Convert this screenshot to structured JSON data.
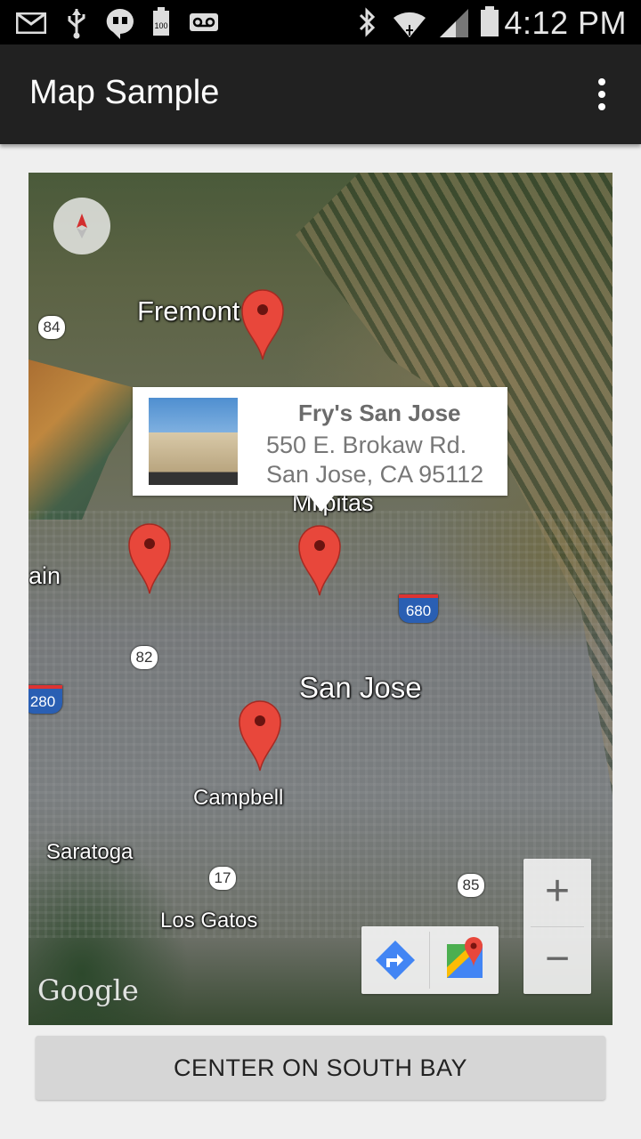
{
  "status_bar": {
    "time": "4:12 PM",
    "icons": [
      "email-icon",
      "usb-icon",
      "hangouts-icon",
      "battery-100-icon",
      "voicemail-icon",
      "bluetooth-icon",
      "wifi-icon",
      "signal-icon",
      "battery-icon"
    ]
  },
  "action_bar": {
    "title": "Map Sample",
    "menu_icon": "overflow-menu-icon"
  },
  "map": {
    "type": "satellite",
    "labels": {
      "fremont": "Fremont",
      "milpitas": "Milpitas",
      "san_jose": "San Jose",
      "campbell": "Campbell",
      "saratoga": "Saratoga",
      "los_gatos": "Los Gatos",
      "mountain_view_partial": "ain"
    },
    "route_shields": {
      "r84": "84",
      "r82": "82",
      "r680": "680",
      "r280": "280",
      "r17": "17",
      "r85": "85"
    },
    "info_window": {
      "title": "Fry's San Jose",
      "address_line1": "550 E. Brokaw Rd.",
      "address_line2": "San Jose, CA 95112"
    },
    "markers_count": 4,
    "attribution": "Google",
    "zoom_in_label": "+",
    "zoom_out_label": "−",
    "colors": {
      "marker": "#e8473b",
      "directions": "#4285f4"
    }
  },
  "bottom_button": {
    "label": "CENTER ON SOUTH BAY"
  }
}
